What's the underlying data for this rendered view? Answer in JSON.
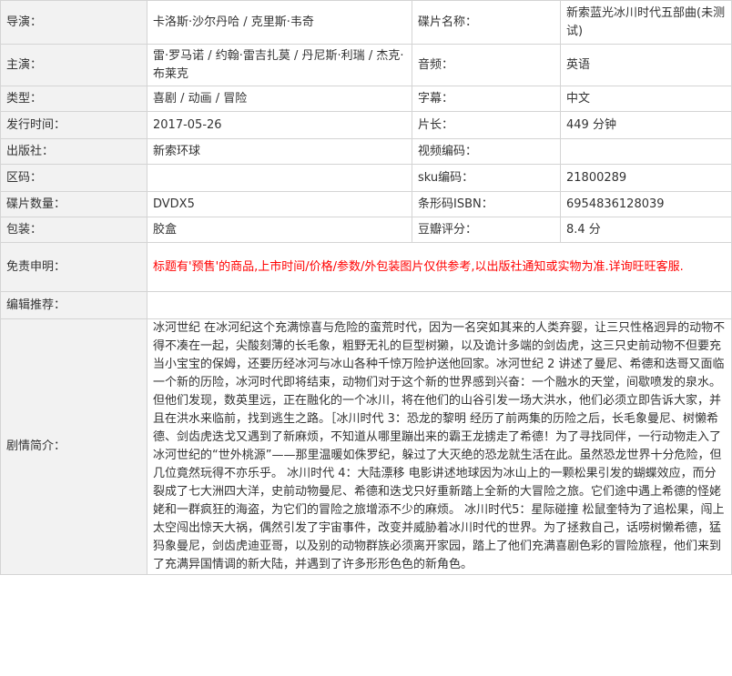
{
  "rows": [
    {
      "label": "导演：",
      "value": "卡洛斯·沙尔丹哈 / 克里斯·韦奇",
      "label2": "碟片名称：",
      "value2": "新索蓝光冰川时代五部曲(未测试)"
    },
    {
      "label": "主演：",
      "value": "雷·罗马诺 / 约翰·雷吉扎莫 / 丹尼斯·利瑞 / 杰克·布莱克",
      "label2": "音频：",
      "value2": "英语"
    },
    {
      "label": "类型：",
      "value": "喜剧 / 动画 / 冒险",
      "label2": "字幕：",
      "value2": "中文"
    },
    {
      "label": "发行时间：",
      "value": "2017-05-26",
      "label2": "片长：",
      "value2": "449 分钟"
    },
    {
      "label": "出版社：",
      "value": "新索环球",
      "label2": "视频编码：",
      "value2": ""
    },
    {
      "label": "区码：",
      "value": "",
      "label2": "sku编码：",
      "value2": "21800289"
    },
    {
      "label": "碟片数量：",
      "value": "DVDX5",
      "label2": "条形码ISBN：",
      "value2": "6954836128039"
    },
    {
      "label": "包装：",
      "value": "胶盒",
      "label2": "豆瓣评分：",
      "value2": "8.4 分"
    }
  ],
  "disclaimer": {
    "label": "免责申明：",
    "text": "标题有'预售'的商品,上市时间/价格/参数/外包装图片仅供参考,以出版社通知或实物为准.详询旺旺客服."
  },
  "editor_pick": {
    "label": "编辑推荐：",
    "text": ""
  },
  "synopsis": {
    "label": "剧情简介：",
    "text": "冰河世纪 在冰河纪这个充满惊喜与危险的蛮荒时代，因为一名突如其来的人类弃婴，让三只性格迥异的动物不得不凑在一起，尖酸刻薄的长毛象，粗野无礼的巨型树獭，以及诡计多端的剑齿虎，这三只史前动物不但要充当小宝宝的保姆，还要历经冰河与冰山各种千惊万险护送他回家。冰河世纪 2 讲述了曼尼、希德和迭哥又面临一个新的历险，冰河时代即将结束，动物们对于这个新的世界感到兴奋：一个融水的天堂，间歇喷发的泉水。但他们发现，数英里远，正在融化的一个冰川，将在他们的山谷引发一场大洪水，他们必须立即告诉大家，并且在洪水来临前，找到逃生之路。［冰川时代 3：恐龙的黎明 经历了前两集的历险之后，长毛象曼尼、树懒希德、剑齿虎迭戈又遇到了新麻烦，不知道从哪里蹦出来的霸王龙掳走了希德！为了寻找同伴，一行动物走入了冰河世纪的“世外桃源”——那里温暖如侏罗纪，躲过了大灭绝的恐龙就生活在此。虽然恐龙世界十分危险，但几位竟然玩得不亦乐乎。 冰川时代 4：大陆漂移 电影讲述地球因为冰山上的一颗松果引发的蝴蝶效应，而分裂成了七大洲四大洋，史前动物曼尼、希德和迭戈只好重新踏上全新的大冒险之旅。它们途中遇上希德的怪姥姥和一群疯狂的海盗，为它们的冒险之旅增添不少的麻烦。 冰川时代5：星际碰撞 松鼠奎特为了追松果，闯上太空闯出惊天大祸，偶然引发了宇宙事件，改变并威胁着冰川时代的世界。为了拯救自己，话唠树懒希德，猛犸象曼尼，剑齿虎迪亚哥，以及别的动物群族必须离开家园，踏上了他们充满喜剧色彩的冒险旅程，他们来到了充满异国情调的新大陆，并遇到了许多形形色色的新角色。"
  },
  "colors": {
    "border": "#d4d4d4",
    "label_bg": "#f2f2f2",
    "text": "#333333",
    "disclaimer": "#ff0000"
  }
}
